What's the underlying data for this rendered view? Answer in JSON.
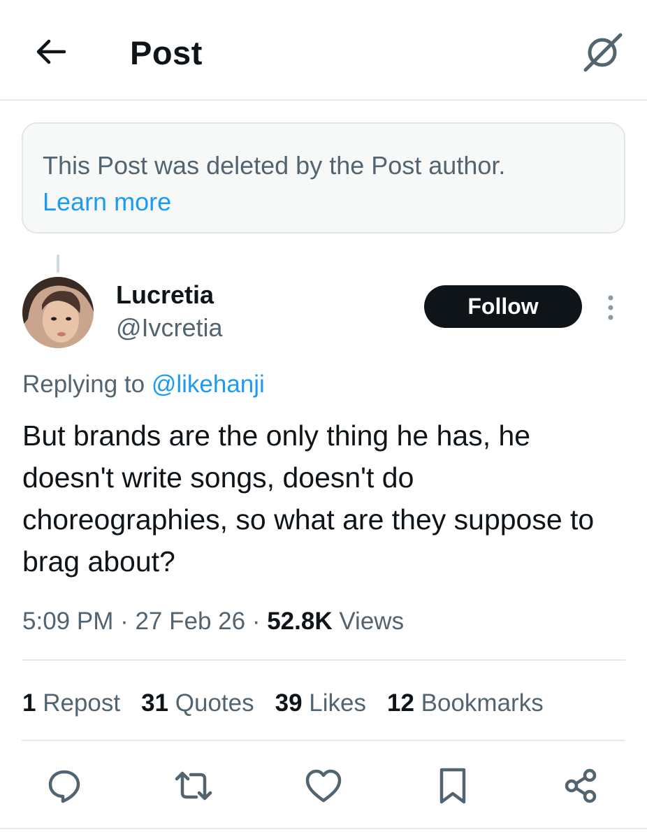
{
  "header": {
    "title": "Post",
    "back_icon": "arrow-left-icon",
    "grok_icon": "grok-icon"
  },
  "deleted_notice": {
    "text": "This Post was deleted by the Post author.",
    "link": "Learn more"
  },
  "author": {
    "display_name": "Lucretia",
    "handle": "@Ivcretia",
    "follow_label": "Follow"
  },
  "reply": {
    "prefix": "Replying to ",
    "mention": "@likehanji"
  },
  "post": {
    "text": "But brands are the only thing he has, he doesn't write songs, doesn't do choreographies, so what are they suppose to brag about?"
  },
  "meta": {
    "time": "5:09 PM",
    "separator": " · ",
    "date": "27 Feb 26",
    "views_count": "52.8K",
    "views_label": " Views"
  },
  "stats": [
    {
      "count": "1",
      "label": " Repost"
    },
    {
      "count": "31",
      "label": " Quotes"
    },
    {
      "count": "39",
      "label": " Likes"
    },
    {
      "count": "12",
      "label": " Bookmarks"
    }
  ],
  "actions": [
    "reply-icon",
    "repost-icon",
    "like-icon",
    "bookmark-icon",
    "share-icon"
  ],
  "colors": {
    "text": "#0f1419",
    "secondary": "#536471",
    "link": "#1d9bf0",
    "border": "#e6e9ec",
    "follow_bg": "#0f1419"
  }
}
